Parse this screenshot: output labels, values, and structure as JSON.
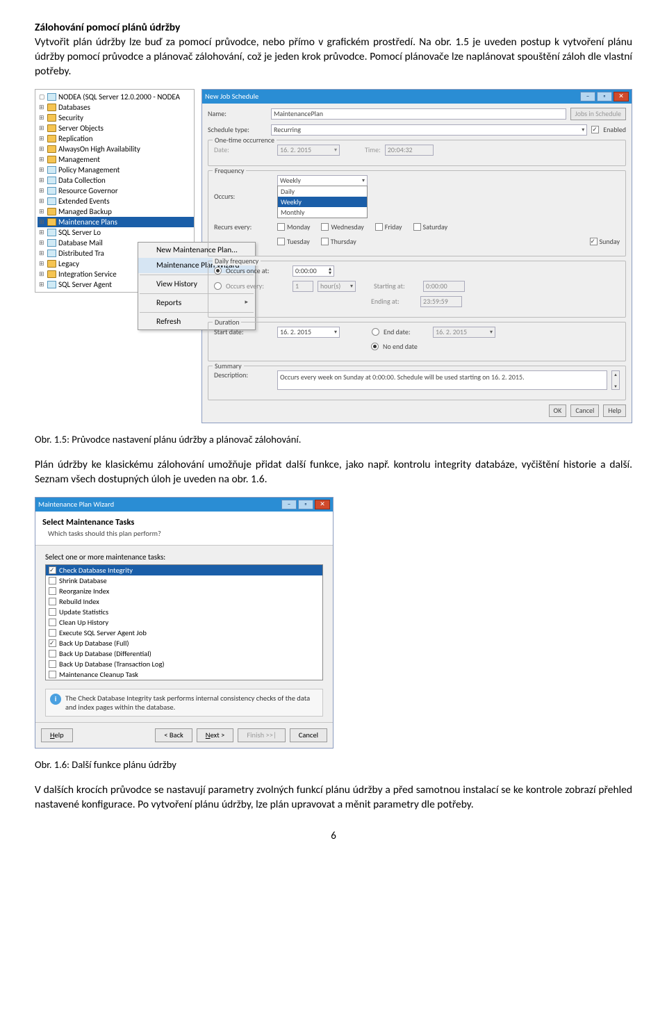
{
  "doc": {
    "heading": "Zálohování pomocí plánů údržby",
    "para1": "Vytvořit plán údržby lze buď za pomocí průvodce, nebo přímo v grafickém prostředí. Na obr. 1.5 je uveden postup k vytvoření plánu údržby pomocí průvodce a plánovač zálohování, což je jeden krok průvodce. Pomocí plánovače lze naplánovat spouštění záloh dle vlastní potřeby.",
    "caption1": "Obr. 1.5: Průvodce nastavení plánu údržby a plánovač zálohování.",
    "para2": "Plán údržby ke klasickému zálohování umožňuje přidat další funkce, jako např. kontrolu integrity databáze, vyčištění historie a další. Seznam všech dostupných úloh je uveden na obr. 1.6.",
    "caption2": "Obr. 1.6: Další funkce plánu údržby",
    "para3": "V dalších krocích průvodce se nastavují parametry zvolných funkcí plánu údržby a před samotnou instalací se ke kontrole zobrazí přehled nastavené konfigurace. Po vytvoření plánu údržby, lze plán upravovat a měnit parametry dle potřeby.",
    "pagenum": "6"
  },
  "tree": {
    "root": "NODEA (SQL Server 12.0.2000 - NODEA",
    "items": [
      {
        "t": "Databases",
        "lvl": 1
      },
      {
        "t": "Security",
        "lvl": 1
      },
      {
        "t": "Server Objects",
        "lvl": 1
      },
      {
        "t": "Replication",
        "lvl": 1
      },
      {
        "t": "AlwaysOn High Availability",
        "lvl": 1
      },
      {
        "t": "Management",
        "lvl": 1
      },
      {
        "t": "Policy Management",
        "lvl": 2,
        "s": 1
      },
      {
        "t": "Data Collection",
        "lvl": 2,
        "s": 1
      },
      {
        "t": "Resource Governor",
        "lvl": 2,
        "s": 1
      },
      {
        "t": "Extended Events",
        "lvl": 2,
        "s": 1
      },
      {
        "t": "Managed Backup",
        "lvl": 2
      },
      {
        "t": "Maintenance Plans",
        "lvl": 2,
        "hl": 1
      },
      {
        "t": "SQL Server Lo",
        "lvl": 2,
        "s": 1
      },
      {
        "t": "Database Mail",
        "lvl": 2,
        "s": 1
      },
      {
        "t": "Distributed Tra",
        "lvl": 2,
        "s": 1
      },
      {
        "t": "Legacy",
        "lvl": 2
      },
      {
        "t": "Integration Service",
        "lvl": 1
      },
      {
        "t": "SQL Server Agent",
        "lvl": 1,
        "s": 1
      }
    ]
  },
  "ctx": {
    "items": [
      {
        "t": "New Maintenance Plan..."
      },
      {
        "t": "Maintenance Plan Wizard",
        "sel": 1
      },
      {
        "t": "View History"
      },
      {
        "t": "Reports",
        "arr": 1
      },
      {
        "t": "Refresh"
      }
    ]
  },
  "sched": {
    "title": "New Job Schedule",
    "name_lbl": "Name:",
    "name_val": "MaintenancePlan",
    "jobs_btn": "Jobs in Schedule",
    "type_lbl": "Schedule type:",
    "type_val": "Recurring",
    "enabled": "Enabled",
    "one_grp": "One-time occurrence",
    "date_lbl": "Date:",
    "date_val": "16. 2. 2015",
    "time_lbl": "Time:",
    "time_val": "20:04:32",
    "freq_grp": "Frequency",
    "occurs_lbl": "Occurs:",
    "occurs_val": "Weekly",
    "occurs_opts": [
      "Daily",
      "Weekly",
      "Monthly"
    ],
    "recurs_lbl": "Recurs every:",
    "days": {
      "mon": "Monday",
      "tue": "Tuesday",
      "wed": "Wednesday",
      "thu": "Thursday",
      "fri": "Friday",
      "sat": "Saturday",
      "sun": "Sunday"
    },
    "daily_grp": "Daily frequency",
    "once_lbl": "Occurs once at:",
    "once_val": "0:00:00",
    "every_lbl": "Occurs every:",
    "every_num": "1",
    "every_unit": "hour(s)",
    "start_at": "Starting at:",
    "start_val": "0:00:00",
    "end_at": "Ending at:",
    "end_val": "23:59:59",
    "dur_grp": "Duration",
    "startd_lbl": "Start date:",
    "startd_val": "16. 2. 2015",
    "endd_lbl": "End date:",
    "endd_val": "16. 2. 2015",
    "noend": "No end date",
    "sum_grp": "Summary",
    "desc_lbl": "Description:",
    "desc_val": "Occurs every week on Sunday at 0:00:00. Schedule will be used starting on 16. 2. 2015.",
    "ok": "OK",
    "cancel": "Cancel",
    "help": "Help"
  },
  "wiz": {
    "title": "Maintenance Plan Wizard",
    "h1": "Select Maintenance Tasks",
    "h2": "Which tasks should this plan perform?",
    "sel_lbl": "Select one or more maintenance tasks:",
    "tasks": [
      {
        "t": "Check Database Integrity",
        "sel": 1
      },
      {
        "t": "Shrink Database"
      },
      {
        "t": "Reorganize Index"
      },
      {
        "t": "Rebuild Index"
      },
      {
        "t": "Update Statistics"
      },
      {
        "t": "Clean Up History"
      },
      {
        "t": "Execute SQL Server Agent Job"
      },
      {
        "t": "Back Up Database (Full)",
        "chk": 1
      },
      {
        "t": "Back Up Database (Differential)"
      },
      {
        "t": "Back Up Database (Transaction Log)"
      },
      {
        "t": "Maintenance Cleanup Task"
      }
    ],
    "info": "The Check Database Integrity task performs internal consistency checks of the data and index pages within the database.",
    "help": "Help",
    "back": "< Back",
    "next": "Next >",
    "finish": "Finish >>|",
    "cancel": "Cancel"
  }
}
